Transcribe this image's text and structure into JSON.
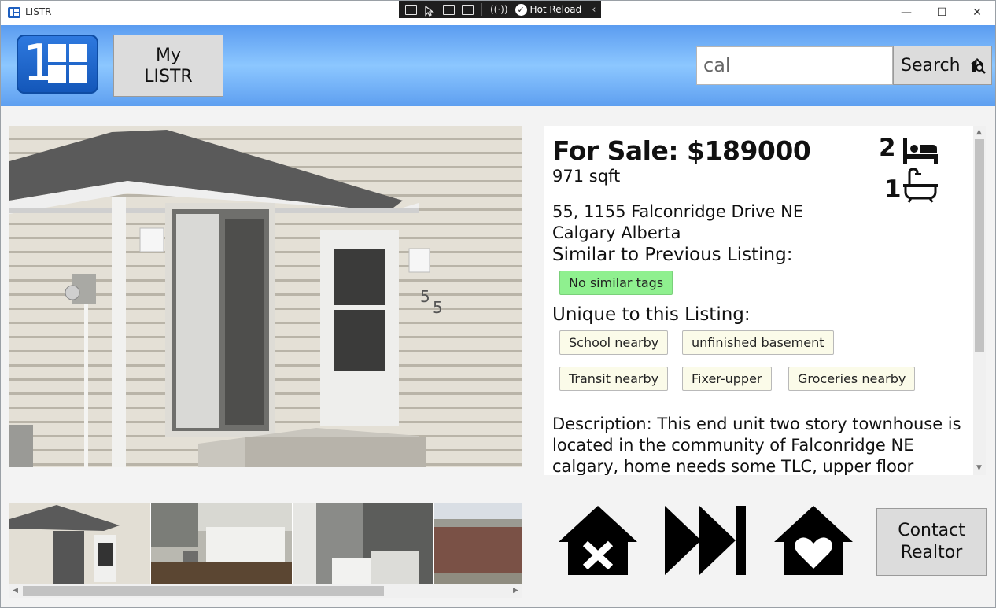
{
  "window": {
    "title": "LISTR",
    "debug_toolbar": {
      "hot_reload_label": "Hot Reload"
    },
    "controls": {
      "minimize": "—",
      "maximize": "☐",
      "close": "✕"
    }
  },
  "header": {
    "logo_text": "1",
    "my_listr_label": "My\nLISTR",
    "search_value": "cal",
    "search_button_label": "Search"
  },
  "listing": {
    "price_line": "For Sale: $189000",
    "sqft": "971 sqft",
    "bedrooms": "2",
    "bathrooms": "1",
    "address_line1": "55, 1155 Falconridge Drive NE",
    "address_line2": "Calgary Alberta",
    "similar_heading": "Similar to Previous Listing:",
    "similar_tags": [
      "No similar tags"
    ],
    "unique_heading": "Unique to this Listing:",
    "unique_tags": [
      "School nearby",
      "unfinished basement",
      "Transit nearby",
      "Fixer-upper",
      "Groceries nearby"
    ],
    "description": "Description: This end unit two story townhouse is located in the community of Falconridge NE calgary, home needs some TLC, upper floor"
  },
  "actions": {
    "reject_icon": "house-x-icon",
    "skip_icon": "skip-forward-icon",
    "favorite_icon": "house-heart-icon",
    "contact_label": "Contact\nRealtor"
  },
  "colors": {
    "header_gradient": "#8cc7ff",
    "logo_blue": "#1356b8",
    "similar_tag": "#8ff08f",
    "unique_tag": "#fbfbe9"
  }
}
